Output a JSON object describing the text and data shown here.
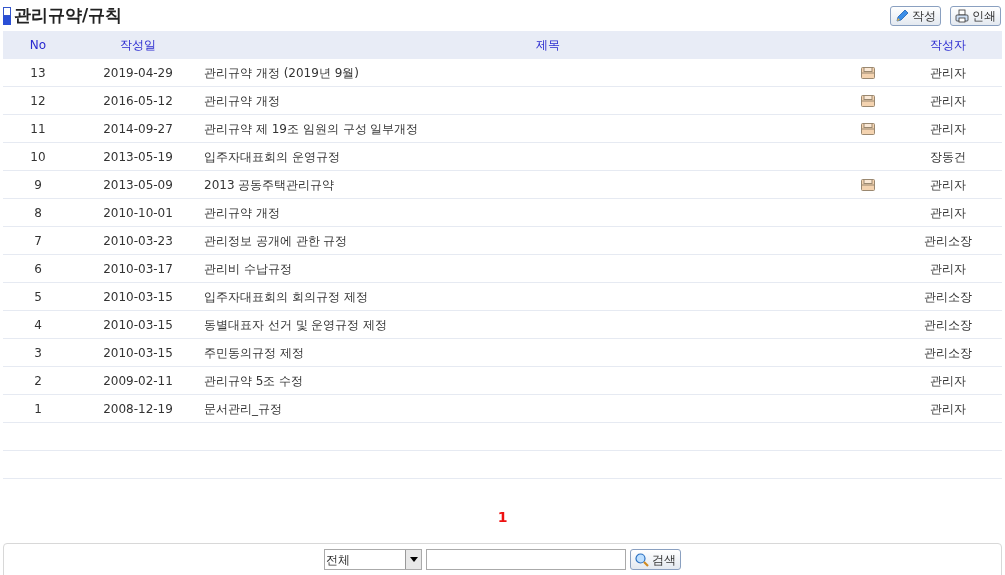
{
  "title": "관리규약/규칙",
  "toolbar": [
    {
      "label": "작성",
      "kind": "write"
    },
    {
      "label": "인쇄",
      "kind": "print"
    }
  ],
  "table": {
    "columns": [
      "No",
      "작성일",
      "제목",
      "작성자"
    ],
    "rows": [
      {
        "no": "13",
        "date": "2019-04-29",
        "subject": "관리규약 개정 (2019년 9월)",
        "attachment": true,
        "author": "관리자"
      },
      {
        "no": "12",
        "date": "2016-05-12",
        "subject": "관리규약 개정",
        "attachment": true,
        "author": "관리자"
      },
      {
        "no": "11",
        "date": "2014-09-27",
        "subject": "관리규약 제 19조 임원의 구성 일부개정",
        "attachment": true,
        "author": "관리자"
      },
      {
        "no": "10",
        "date": "2013-05-19",
        "subject": "입주자대표회의 운영규정",
        "attachment": false,
        "author": "장동건"
      },
      {
        "no": "9",
        "date": "2013-05-09",
        "subject": "2013 공동주택관리규약",
        "attachment": true,
        "author": "관리자"
      },
      {
        "no": "8",
        "date": "2010-10-01",
        "subject": "관리규약 개정",
        "attachment": false,
        "author": "관리자"
      },
      {
        "no": "7",
        "date": "2010-03-23",
        "subject": "관리정보 공개에 관한 규정",
        "attachment": false,
        "author": "관리소장"
      },
      {
        "no": "6",
        "date": "2010-03-17",
        "subject": "관리비 수납규정",
        "attachment": false,
        "author": "관리자"
      },
      {
        "no": "5",
        "date": "2010-03-15",
        "subject": "입주자대표회의 회의규정 제정",
        "attachment": false,
        "author": "관리소장"
      },
      {
        "no": "4",
        "date": "2010-03-15",
        "subject": "동별대표자 선거 및 운영규정 제정",
        "attachment": false,
        "author": "관리소장"
      },
      {
        "no": "3",
        "date": "2010-03-15",
        "subject": "주민동의규정 제정",
        "attachment": false,
        "author": "관리소장"
      },
      {
        "no": "2",
        "date": "2009-02-11",
        "subject": "관리규약 5조 수정",
        "attachment": false,
        "author": "관리자"
      },
      {
        "no": "1",
        "date": "2008-12-19",
        "subject": "문서관리_규정",
        "attachment": false,
        "author": "관리자"
      }
    ]
  },
  "pagination": [
    {
      "label": "1",
      "selected": true
    }
  ],
  "search": {
    "scope": "전체",
    "button": "검색"
  }
}
